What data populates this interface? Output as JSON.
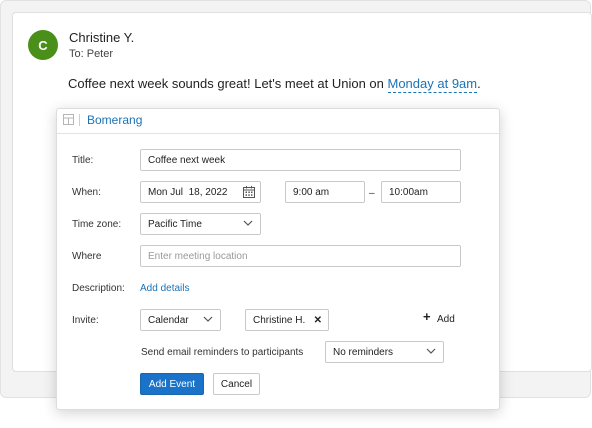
{
  "email": {
    "sender": "Christine Y.",
    "avatar_initial": "C",
    "recipient": "To: Peter",
    "message_prefix": "Coffee next week sounds great! Let's meet at Union on ",
    "message_link": "Monday at 9am",
    "message_suffix": "."
  },
  "popup": {
    "title": "Bomerang",
    "fields": {
      "title_label": "Title:",
      "title_value": "Coffee next week",
      "when_label": "When:",
      "date_value": "Mon Jul  18, 2022",
      "start_time": "9:00 am",
      "time_separator": "–",
      "end_time": "10:00am",
      "timezone_label": "Time zone:",
      "timezone_value": "Pacific Time",
      "where_label": "Where",
      "where_placeholder": "Enter meeting location",
      "description_label": "Description:",
      "description_link": "Add details",
      "invite_label": "Invite:",
      "invite_source": "Calendar",
      "invitee": "Christine H.",
      "add_label": "Add",
      "reminder_label": "Send email reminders to participants",
      "reminder_value": "No reminders"
    },
    "buttons": {
      "add_event": "Add Event",
      "cancel": "Cancel"
    }
  },
  "colors": {
    "accent": "#1a73b8",
    "avatar_bg": "#4a8f1a",
    "primary_button": "#1a73c8"
  }
}
